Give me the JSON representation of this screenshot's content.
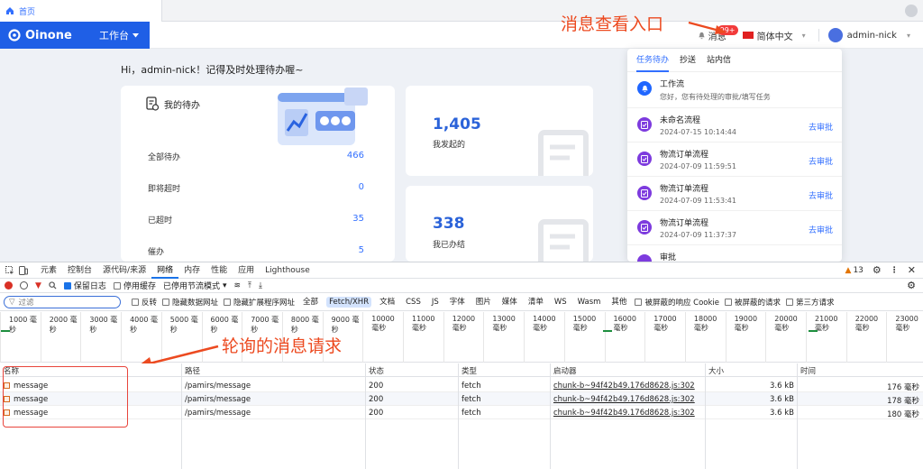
{
  "browser": {
    "tab_label": "首页"
  },
  "header": {
    "logo_text": "Oinone",
    "workbench": "工作台",
    "messages_label": "消息",
    "messages_badge": "99+",
    "language": "简体中文",
    "username": "admin-nick"
  },
  "annotations": {
    "message_entry": "消息查看入口",
    "polling_requests": "轮询的消息请求"
  },
  "greeting": "Hi，admin-nick！记得及时处理待办喔~",
  "todo": {
    "title": "我的待办",
    "rows": [
      {
        "label": "全部待办",
        "value": "466"
      },
      {
        "label": "即将超时",
        "value": "0"
      },
      {
        "label": "已超时",
        "value": "35"
      },
      {
        "label": "催办",
        "value": "5"
      }
    ]
  },
  "stats": [
    {
      "value": "1,405",
      "label": "我发起的"
    },
    {
      "value": "338",
      "label": "我已办结"
    }
  ],
  "notifications": {
    "tabs": [
      "任务待办",
      "抄送",
      "站内信"
    ],
    "active_tab": "任务待办",
    "items": [
      {
        "title": "工作流",
        "subtitle": "您好，您有待处理的审批/填写任务",
        "action": "",
        "icon_color": "#1f66ff"
      },
      {
        "title": "未命名流程",
        "subtitle": "2024-07-15 10:14:44",
        "action": "去审批",
        "icon_color": "#7d3bde"
      },
      {
        "title": "物流订单流程",
        "subtitle": "2024-07-09 11:59:51",
        "action": "去审批",
        "icon_color": "#7d3bde"
      },
      {
        "title": "物流订单流程",
        "subtitle": "2024-07-09 11:53:41",
        "action": "去审批",
        "icon_color": "#7d3bde"
      },
      {
        "title": "物流订单流程",
        "subtitle": "2024-07-09 11:37:37",
        "action": "去审批",
        "icon_color": "#7d3bde"
      },
      {
        "title": "审批",
        "subtitle": "",
        "action": "",
        "icon_color": "#7d3bde"
      }
    ]
  },
  "devtools": {
    "tabs": [
      "元素",
      "控制台",
      "源代码/来源",
      "网络",
      "内存",
      "性能",
      "应用",
      "Lighthouse"
    ],
    "active_tab": "网络",
    "issues_count": "13",
    "toolbar": {
      "preserve_log": "保留日志",
      "disable_cache": "停用缓存",
      "throttle": "已停用节流模式"
    },
    "filter": {
      "placeholder": "过滤",
      "invert": "反转",
      "hide_data_urls": "隐藏数据网址",
      "hide_ext_urls": "隐藏扩展程序网址",
      "types": [
        "全部",
        "Fetch/XHR",
        "文档",
        "CSS",
        "JS",
        "字体",
        "图片",
        "媒体",
        "清单",
        "WS",
        "Wasm",
        "其他"
      ],
      "selected_type": "Fetch/XHR",
      "blocked_cookies": "被屏蔽的响应 Cookie",
      "blocked_requests": "被屏蔽的请求",
      "third_party": "第三方请求"
    },
    "timeline_ticks": [
      "1000 毫秒",
      "2000 毫秒",
      "3000 毫秒",
      "4000 毫秒",
      "5000 毫秒",
      "6000 毫秒",
      "7000 毫秒",
      "8000 毫秒",
      "9000 毫秒",
      "10000 毫秒",
      "11000 毫秒",
      "12000 毫秒",
      "13000 毫秒",
      "14000 毫秒",
      "15000 毫秒",
      "16000 毫秒",
      "17000 毫秒",
      "18000 毫秒",
      "19000 毫秒",
      "20000 毫秒",
      "21000 毫秒",
      "22000 毫秒",
      "23000 毫秒"
    ],
    "columns": [
      "名称",
      "路径",
      "状态",
      "类型",
      "启动器",
      "大小",
      "时间"
    ],
    "requests": [
      {
        "name": "message",
        "path": "/pamirs/message",
        "status": "200",
        "type": "fetch",
        "initiator": "chunk-b~94f42b49.176d8628.js:302",
        "size": "3.6 kB",
        "time": "176 毫秒"
      },
      {
        "name": "message",
        "path": "/pamirs/message",
        "status": "200",
        "type": "fetch",
        "initiator": "chunk-b~94f42b49.176d8628.js:302",
        "size": "3.6 kB",
        "time": "178 毫秒"
      },
      {
        "name": "message",
        "path": "/pamirs/message",
        "status": "200",
        "type": "fetch",
        "initiator": "chunk-b~94f42b49.176d8628.js:302",
        "size": "3.6 kB",
        "time": "180 毫秒"
      }
    ]
  }
}
